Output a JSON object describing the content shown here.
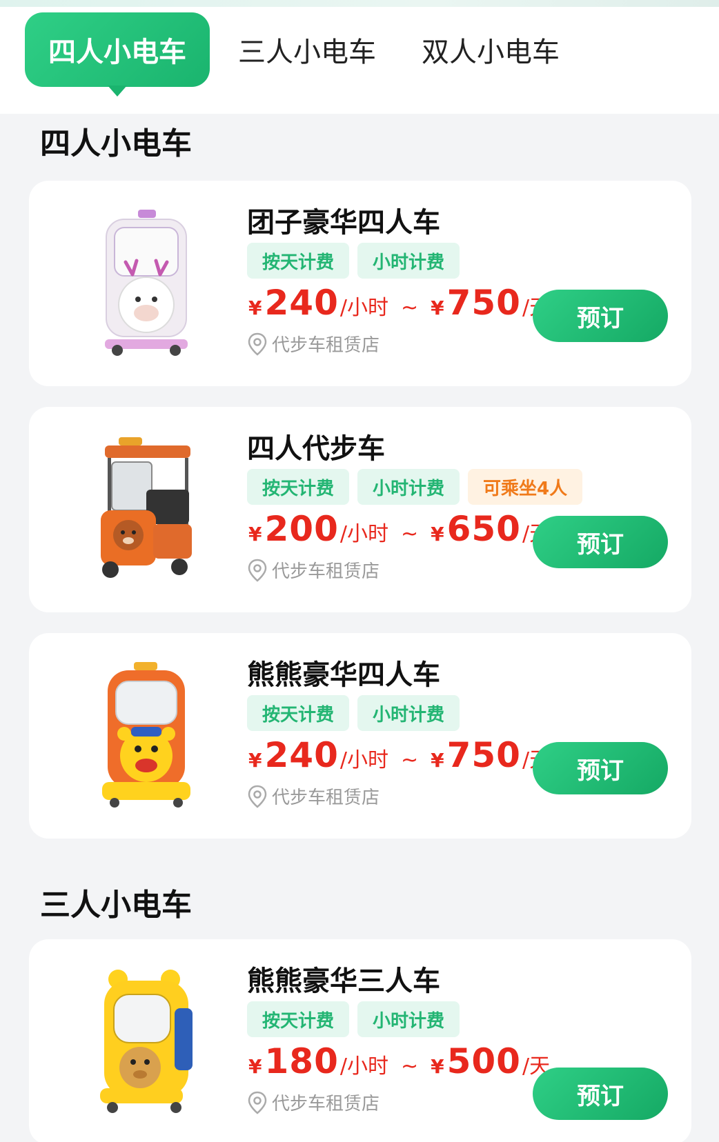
{
  "tabs": [
    {
      "label": "四人小电车",
      "active": true
    },
    {
      "label": "三人小电车",
      "active": false
    },
    {
      "label": "双人小电车",
      "active": false
    }
  ],
  "sections": [
    {
      "title": "四人小电车",
      "items": [
        {
          "name": "团子豪华四人车",
          "tags": [
            "按天计费",
            "小时计费"
          ],
          "price_hour": "240",
          "hour_unit": "/小时",
          "price_day": "750",
          "day_unit": "/天",
          "currency": "¥",
          "tilde": "~",
          "store": "代步车租赁店",
          "button": "预订",
          "image_icon": "white-bear-car-icon"
        },
        {
          "name": "四人代步车",
          "tags": [
            "按天计费",
            "小时计费",
            "可乘坐4人"
          ],
          "price_hour": "200",
          "hour_unit": "/小时",
          "price_day": "650",
          "day_unit": "/天",
          "currency": "¥",
          "tilde": "~",
          "store": "代步车租赁店",
          "button": "预订",
          "image_icon": "orange-open-car-icon"
        },
        {
          "name": "熊熊豪华四人车",
          "tags": [
            "按天计费",
            "小时计费"
          ],
          "price_hour": "240",
          "hour_unit": "/小时",
          "price_day": "750",
          "day_unit": "/天",
          "currency": "¥",
          "tilde": "~",
          "store": "代步车租赁店",
          "button": "预订",
          "image_icon": "orange-bear-car-icon"
        }
      ]
    },
    {
      "title": "三人小电车",
      "items": [
        {
          "name": "熊熊豪华三人车",
          "tags": [
            "按天计费",
            "小时计费"
          ],
          "price_hour": "180",
          "hour_unit": "/小时",
          "price_day": "500",
          "day_unit": "/天",
          "currency": "¥",
          "tilde": "~",
          "store": "代步车租赁店",
          "button": "预订",
          "image_icon": "yellow-bear-car-icon"
        }
      ]
    }
  ],
  "colors": {
    "accent": "#1ab46e",
    "price": "#e8281d",
    "tag_green_bg": "#e4f7ef",
    "tag_orange_text": "#f07a1a"
  }
}
